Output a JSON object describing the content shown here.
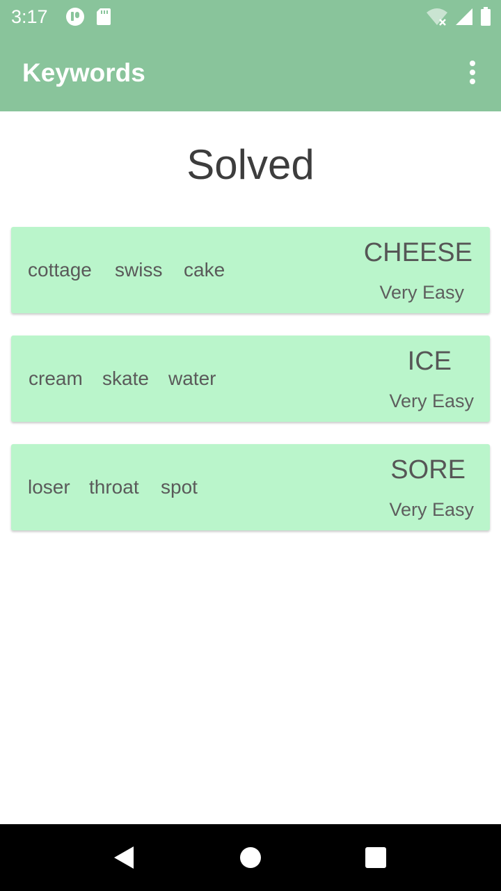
{
  "status_bar": {
    "time": "3:17",
    "left_icons": [
      "app-notification-icon",
      "sd-card-icon"
    ],
    "right_icons": [
      "wifi-off-icon",
      "signal-icon",
      "battery-icon"
    ]
  },
  "app_bar": {
    "title": "Keywords",
    "menu_icon": "more-vert-icon",
    "color": "#89c49b"
  },
  "page": {
    "title": "Solved"
  },
  "cards": [
    {
      "clues": [
        "cottage",
        "swiss",
        "cake"
      ],
      "answer": "CHEESE",
      "difficulty": "Very Easy"
    },
    {
      "clues": [
        "cream",
        "skate",
        "water"
      ],
      "answer": "ICE",
      "difficulty": "Very Easy"
    },
    {
      "clues": [
        "loser",
        "throat",
        "spot"
      ],
      "answer": "SORE",
      "difficulty": "Very Easy"
    }
  ],
  "card_color": "#baf5cb",
  "nav_bar": {
    "buttons": [
      "back-icon",
      "home-icon",
      "recents-icon"
    ]
  }
}
